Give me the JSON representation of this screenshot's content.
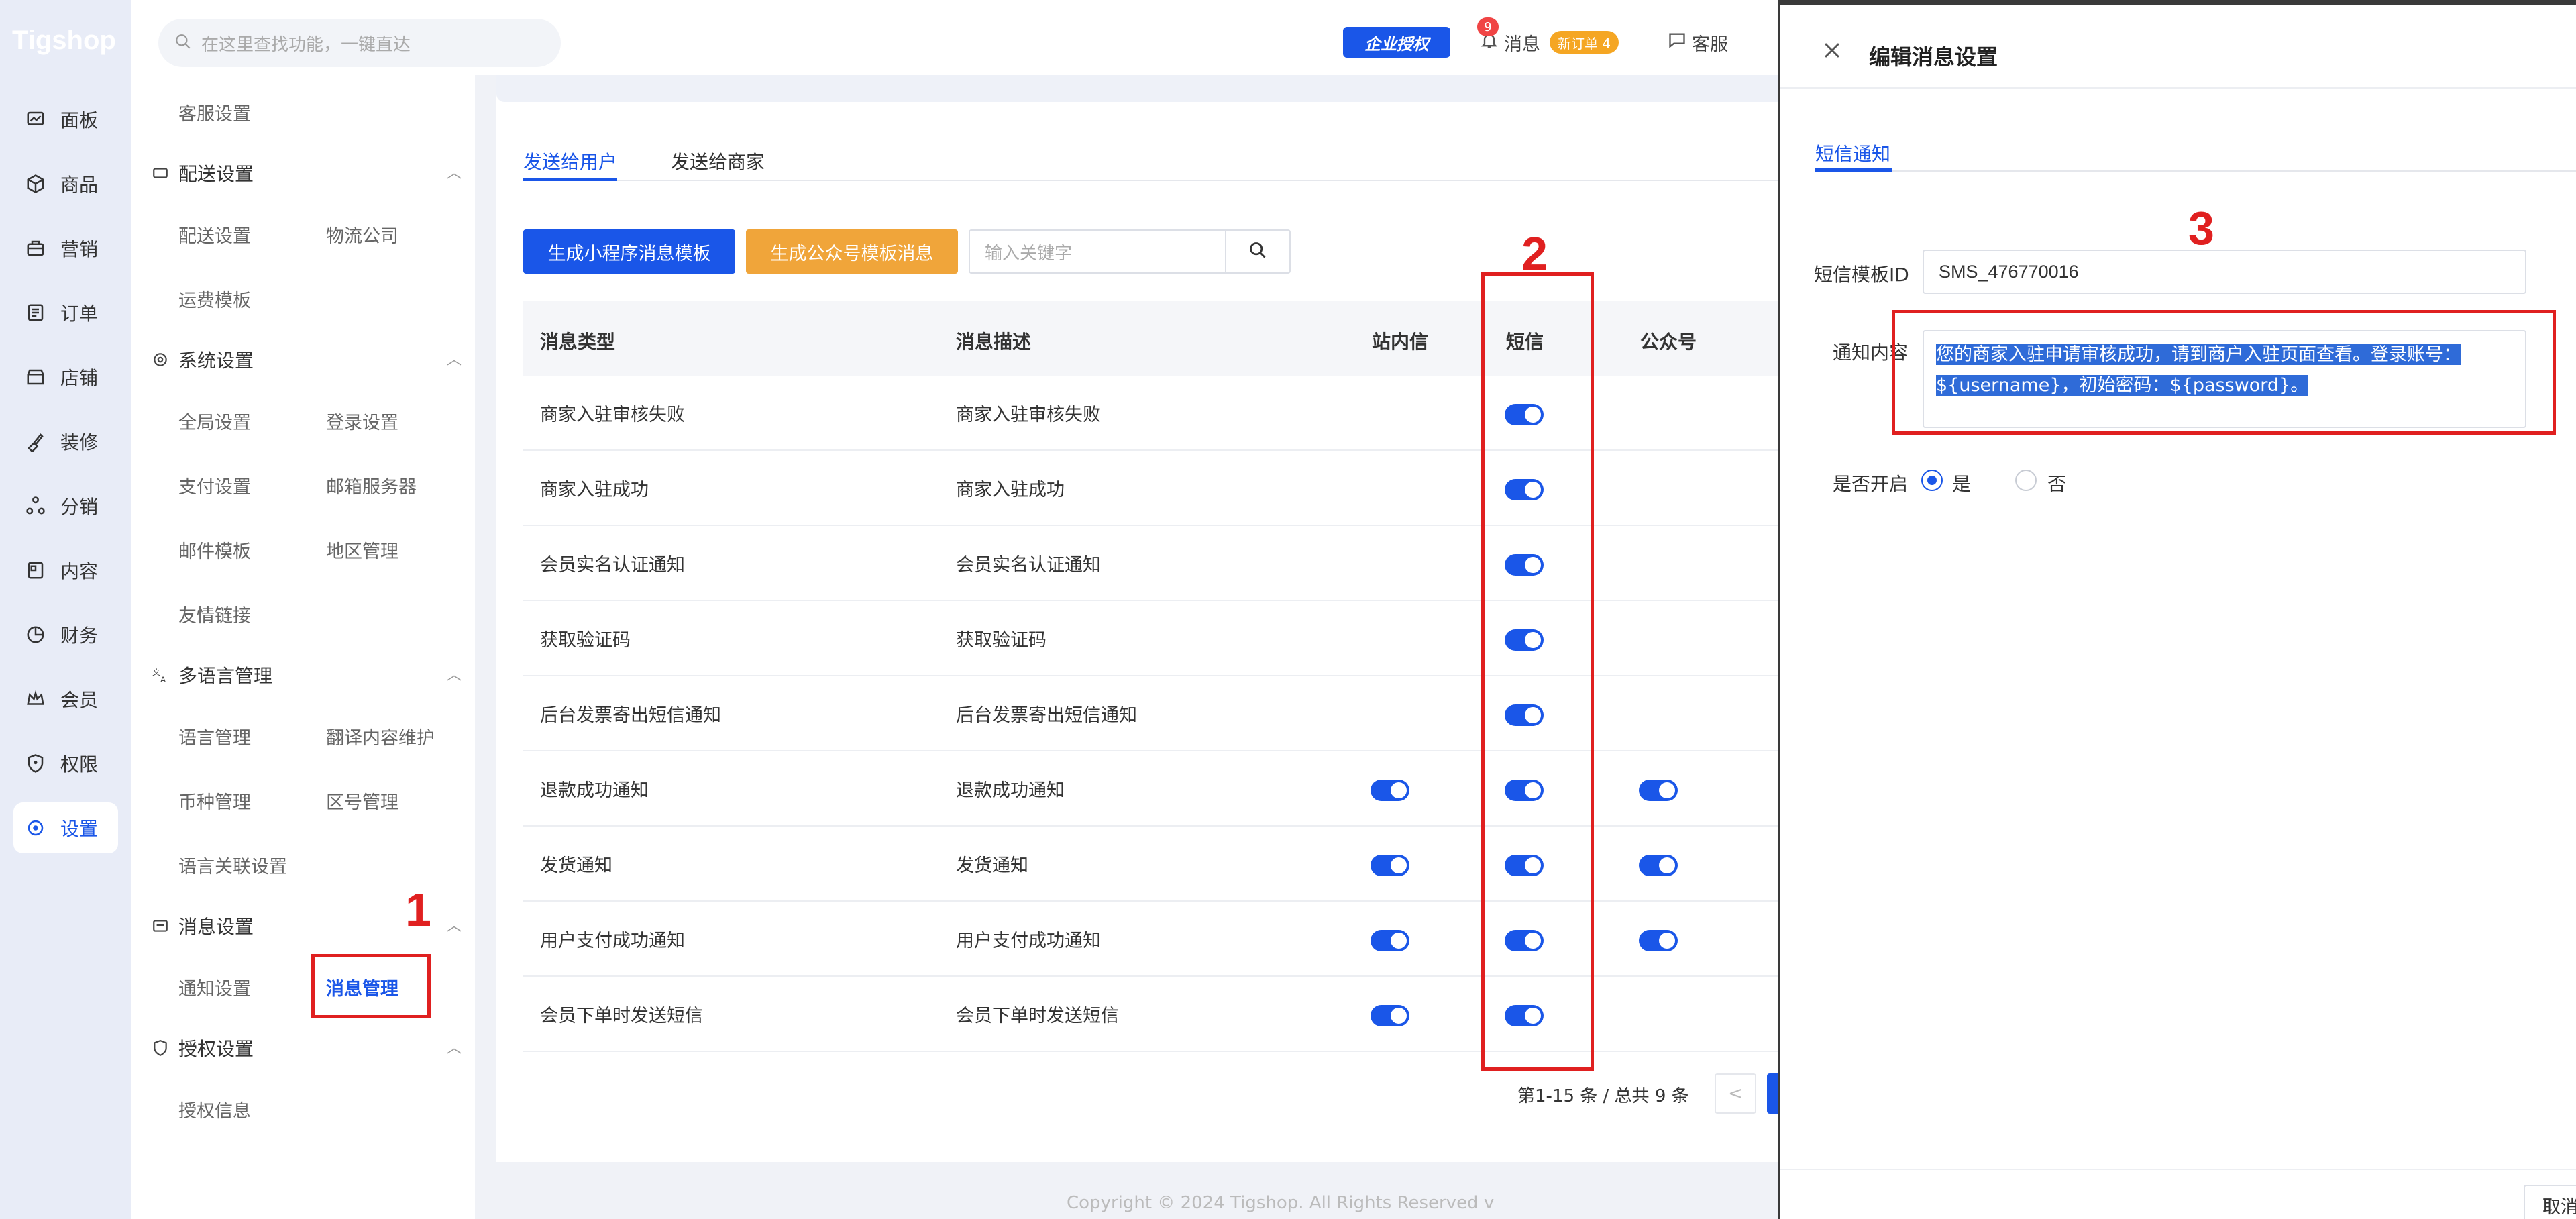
{
  "app": {
    "logo": "Tigshop"
  },
  "header": {
    "search_placeholder": "在这里查找功能，一键直达",
    "enterprise_badge": "企业授权",
    "messages_label": "消息",
    "messages_count": "9",
    "new_orders": "新订单 4",
    "service_label": "客服"
  },
  "nav": {
    "items": [
      "面板",
      "商品",
      "营销",
      "订单",
      "店铺",
      "装修",
      "分销",
      "内容",
      "财务",
      "会员",
      "权限",
      "设置"
    ]
  },
  "subnav": {
    "top_link": "客服设置",
    "groups": [
      {
        "title": "配送设置",
        "links": [
          "配送设置",
          "物流公司",
          "运费模板"
        ]
      },
      {
        "title": "系统设置",
        "links": [
          "全局设置",
          "登录设置",
          "支付设置",
          "邮箱服务器",
          "邮件模板",
          "地区管理",
          "友情链接"
        ]
      },
      {
        "title": "多语言管理",
        "links": [
          "语言管理",
          "翻译内容维护",
          "币种管理",
          "区号管理",
          "语言关联设置"
        ]
      },
      {
        "title": "消息设置",
        "links": [
          "通知设置",
          "消息管理"
        ]
      },
      {
        "title": "授权设置",
        "links": [
          "授权信息"
        ]
      }
    ]
  },
  "main": {
    "tabs": [
      "发送给用户",
      "发送给商家"
    ],
    "btn_mini_template": "生成小程序消息模板",
    "btn_mp_template": "生成公众号模板消息",
    "keyword_placeholder": "输入关键字",
    "columns": [
      "消息类型",
      "消息描述",
      "站内信",
      "短信",
      "公众号"
    ],
    "rows": [
      {
        "type": "商家入驻审核失败",
        "desc": "商家入驻审核失败",
        "site": false,
        "sms": true,
        "mp": false
      },
      {
        "type": "商家入驻成功",
        "desc": "商家入驻成功",
        "site": false,
        "sms": true,
        "mp": false
      },
      {
        "type": "会员实名认证通知",
        "desc": "会员实名认证通知",
        "site": false,
        "sms": true,
        "mp": false
      },
      {
        "type": "获取验证码",
        "desc": "获取验证码",
        "site": false,
        "sms": true,
        "mp": false
      },
      {
        "type": "后台发票寄出短信通知",
        "desc": "后台发票寄出短信通知",
        "site": false,
        "sms": true,
        "mp": false
      },
      {
        "type": "退款成功通知",
        "desc": "退款成功通知",
        "site": true,
        "sms": true,
        "mp": true
      },
      {
        "type": "发货通知",
        "desc": "发货通知",
        "site": true,
        "sms": true,
        "mp": true
      },
      {
        "type": "用户支付成功通知",
        "desc": "用户支付成功通知",
        "site": true,
        "sms": true,
        "mp": true
      },
      {
        "type": "会员下单时发送短信",
        "desc": "会员下单时发送短信",
        "site": true,
        "sms": true,
        "mp": false
      }
    ],
    "pager_text": "第1-15 条 / 总共 9 条",
    "pager_prev": "<",
    "copyright": "Copyright © 2024 Tigshop. All Rights Reserved  v"
  },
  "annotations": [
    "1",
    "2",
    "3"
  ],
  "drawer": {
    "title": "编辑消息设置",
    "tab": "短信通知",
    "template_id_label": "短信模板ID",
    "template_id_value": "SMS_476770016",
    "content_label": "通知内容",
    "content_line1": "您的商家入驻申请审核成功，请到商户入驻页面查看。登录账号：",
    "content_line2": "${username}，初始密码：${password}。",
    "enable_label": "是否开启",
    "yes_label": "是",
    "no_label": "否",
    "cancel_label": "取消"
  },
  "colors": {
    "accent": "#1a56e8",
    "orange": "#f0a53a",
    "annotation": "#e02020"
  }
}
